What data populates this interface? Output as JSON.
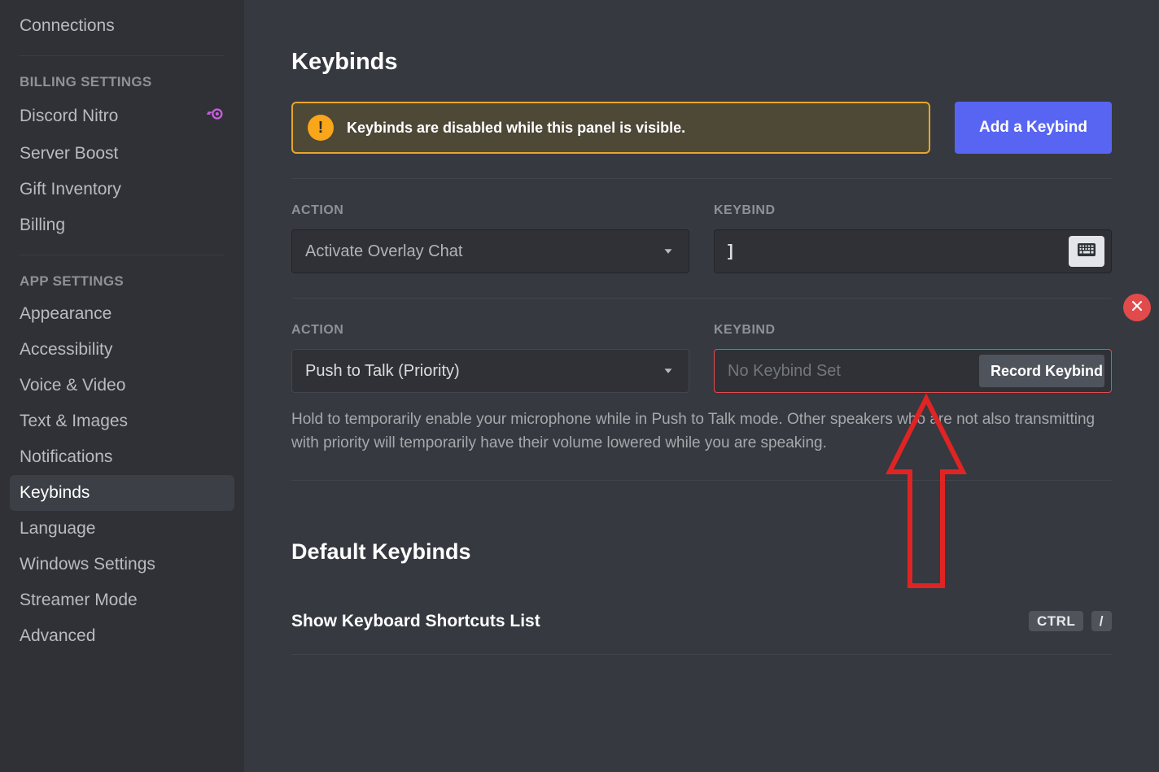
{
  "sidebar": {
    "section_billing_header": "BILLING SETTINGS",
    "section_app_header": "APP SETTINGS",
    "connections": "Connections",
    "nitro": "Discord Nitro",
    "server_boost": "Server Boost",
    "gift_inventory": "Gift Inventory",
    "billing": "Billing",
    "appearance": "Appearance",
    "accessibility": "Accessibility",
    "voice_video": "Voice & Video",
    "text_images": "Text & Images",
    "notifications": "Notifications",
    "keybinds": "Keybinds",
    "language": "Language",
    "windows_settings": "Windows Settings",
    "streamer_mode": "Streamer Mode",
    "advanced": "Advanced"
  },
  "main": {
    "title": "Keybinds",
    "warning": "Keybinds are disabled while this panel is visible.",
    "add_button": "Add a Keybind",
    "labels": {
      "action": "ACTION",
      "keybind": "KEYBIND"
    },
    "row1": {
      "action_value": "Activate Overlay Chat",
      "keybind_value": "]"
    },
    "row2": {
      "action_value": "Push to Talk (Priority)",
      "keybind_placeholder": "No Keybind Set",
      "record_label": "Record Keybind",
      "description": "Hold to temporarily enable your microphone while in Push to Talk mode. Other speakers who are not also transmitting with priority will temporarily have their volume lowered while you are speaking."
    },
    "default_section_title": "Default Keybinds",
    "default_rows": {
      "show_shortcuts": "Show Keyboard Shortcuts List",
      "show_shortcuts_key1": "CTRL",
      "show_shortcuts_key2": "/"
    }
  }
}
